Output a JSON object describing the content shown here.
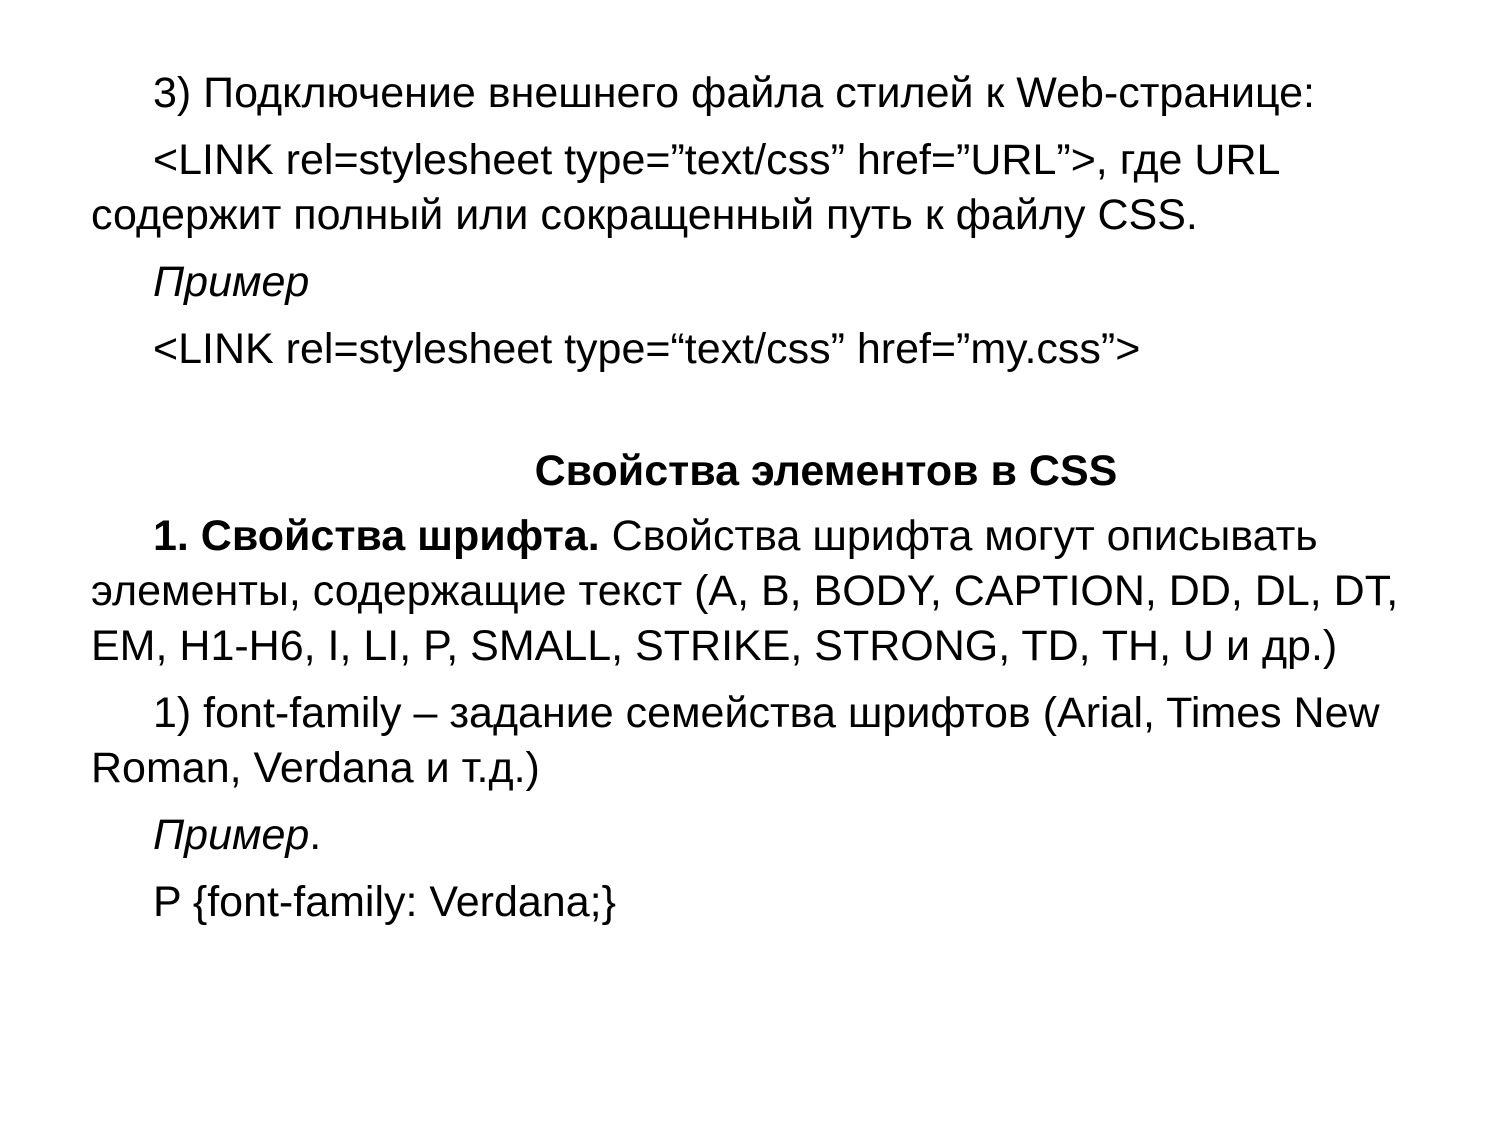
{
  "slide": {
    "p1": "3) Подключение внешнего файла стилей к Web-странице:",
    "p2": "<LINK rel=stylesheet type=”text/css” href=”URL”>, где URL содержит полный или сокращенный путь к файлу CSS.",
    "example_label_1": "Пример",
    "p3": "<LINK rel=stylesheet type=“text/css” href=”my.css”>",
    "section_heading": "Свойства элементов в CSS",
    "p4_bold": "1. Свойства шрифта.",
    "p4_rest": " Свойства шрифта могут описывать элементы, содержащие текст (A, B, BODY, CAPTION, DD, DL, DT, EM, H1-H6, I, LI, P, SMALL, STRIKE, STRONG, TD, TH, U и др.)",
    "p5": "1) font-family – задание семейства шрифтов (Arial, Times New Roman, Verdana и т.д.)",
    "example_label_2": "Пример",
    "example_label_2_suffix": ".",
    "p6": "P {font-family: Verdana;}"
  }
}
